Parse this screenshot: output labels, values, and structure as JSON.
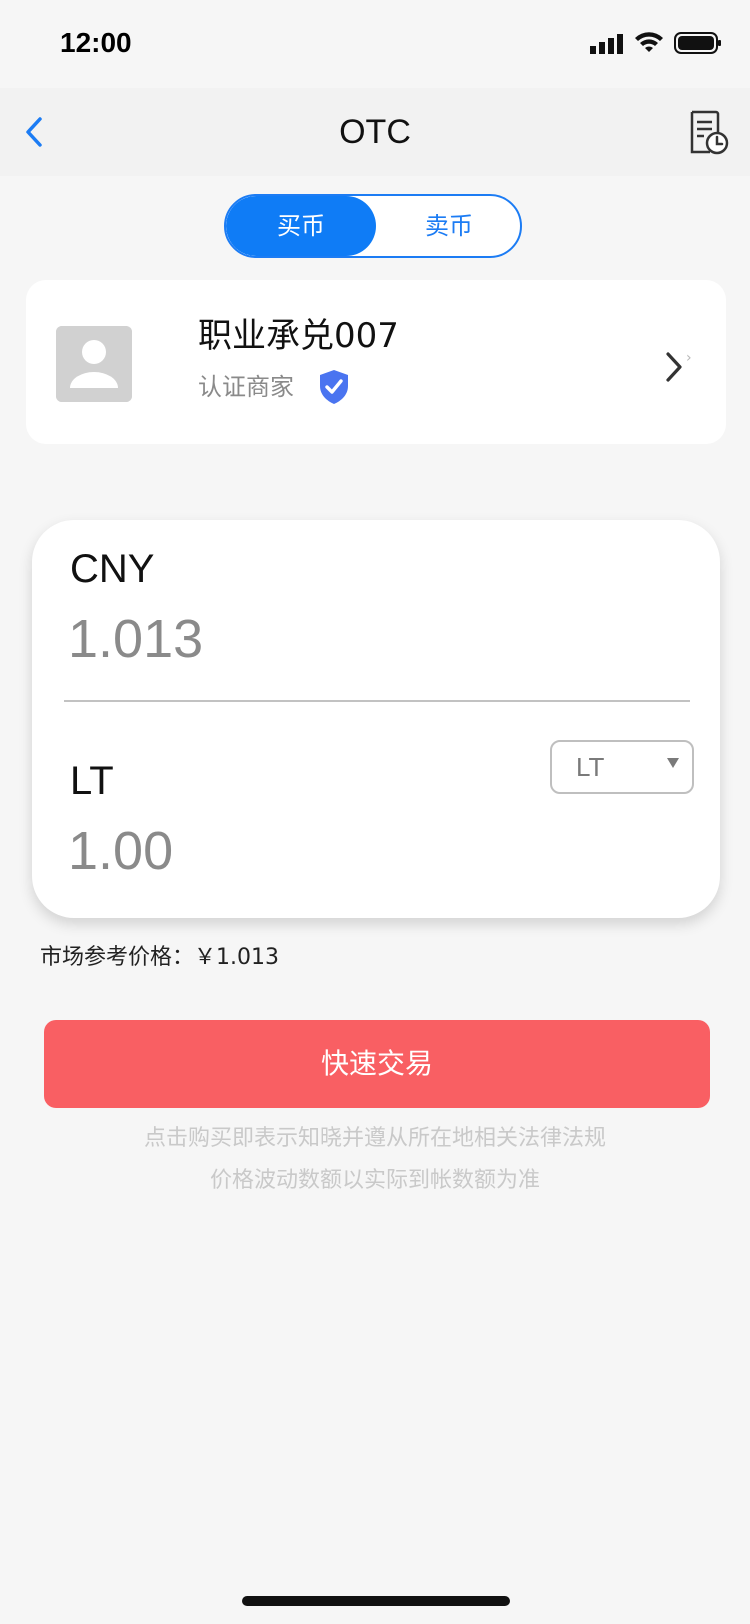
{
  "status_bar": {
    "time": "12:00",
    "icons": [
      "cellular-signal-icon",
      "wifi-icon",
      "battery-icon"
    ]
  },
  "nav": {
    "title": "OTC",
    "back_icon": "chevron-left-icon",
    "history_icon": "order-history-icon"
  },
  "segment": {
    "buy_label": "买币",
    "sell_label": "卖币",
    "selected": "买币"
  },
  "merchant": {
    "name": "职业承兑007",
    "tag": "认证商家",
    "verified_icon": "verified-shield-icon",
    "avatar_icon": "user-avatar-icon"
  },
  "quote": {
    "fiat_label": "CNY",
    "fiat_value": "1.013",
    "coin_label": "LT",
    "coin_value": "1.00",
    "coin_select_value": "LT"
  },
  "market": {
    "label": "市场参考价格：",
    "value": "￥1.013"
  },
  "action": {
    "trade_label": "快速交易"
  },
  "notices": {
    "line1": "点击购买即表示知晓并遵从所在地相关法律法规",
    "line2": "价格波动数额以实际到帐数额为准"
  },
  "colors": {
    "accent_blue": "#0f7cf6",
    "trade_red": "#f95f63",
    "background": "#f6f6f6"
  }
}
